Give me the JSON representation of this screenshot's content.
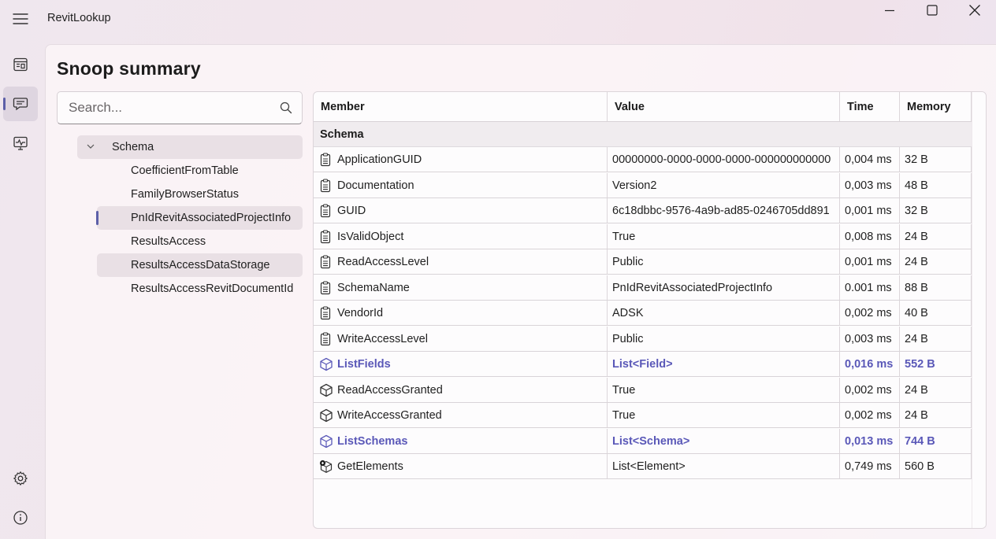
{
  "window": {
    "title": "RevitLookup"
  },
  "page": {
    "title": "Snoop summary"
  },
  "search": {
    "placeholder": "Search..."
  },
  "tree": {
    "root": "Schema",
    "items": [
      "CoefficientFromTable",
      "FamilyBrowserStatus",
      "PnIdRevitAssociatedProjectInfo",
      "ResultsAccess",
      "ResultsAccessDataStorage",
      "ResultsAccessRevitDocumentId"
    ],
    "selected_index": 2,
    "hover_index": 4
  },
  "table": {
    "columns": [
      "Member",
      "Value",
      "Time",
      "Memory"
    ],
    "group": "Schema",
    "rows": [
      {
        "member": "ApplicationGUID",
        "value": "00000000-0000-0000-0000-000000000000",
        "time": "0,004 ms",
        "memory": "32 B",
        "icon": "property-icon",
        "link": false
      },
      {
        "member": "Documentation",
        "value": "Version2",
        "time": "0,003 ms",
        "memory": "48 B",
        "icon": "property-icon",
        "link": false
      },
      {
        "member": "GUID",
        "value": "6c18dbbc-9576-4a9b-ad85-0246705dd891",
        "time": "0,001 ms",
        "memory": "32 B",
        "icon": "property-icon",
        "link": false
      },
      {
        "member": "IsValidObject",
        "value": "True",
        "time": "0,008 ms",
        "memory": "24 B",
        "icon": "property-icon",
        "link": false
      },
      {
        "member": "ReadAccessLevel",
        "value": "Public",
        "time": "0,001 ms",
        "memory": "24 B",
        "icon": "property-icon",
        "link": false
      },
      {
        "member": "SchemaName",
        "value": "PnIdRevitAssociatedProjectInfo",
        "time": "0.001 ms",
        "memory": "88 B",
        "icon": "property-icon",
        "link": false
      },
      {
        "member": "VendorId",
        "value": "ADSK",
        "time": "0,002 ms",
        "memory": "40 B",
        "icon": "property-icon",
        "link": false
      },
      {
        "member": "WriteAccessLevel",
        "value": "Public",
        "time": "0,003 ms",
        "memory": "24 B",
        "icon": "property-icon",
        "link": false
      },
      {
        "member": "ListFields",
        "value": "List<Field>",
        "time": "0,016 ms",
        "memory": "552 B",
        "icon": "method-cube-icon",
        "link": true
      },
      {
        "member": "ReadAccessGranted",
        "value": "True",
        "time": "0,002 ms",
        "memory": "24 B",
        "icon": "method-cube-icon",
        "link": false
      },
      {
        "member": "WriteAccessGranted",
        "value": "True",
        "time": "0,002 ms",
        "memory": "24 B",
        "icon": "method-cube-icon",
        "link": false
      },
      {
        "member": "ListSchemas",
        "value": "List<Schema>",
        "time": "0,013 ms",
        "memory": "744 B",
        "icon": "method-cube-icon",
        "link": true
      },
      {
        "member": "GetElements",
        "value": "List<Element>",
        "time": "0,749 ms",
        "memory": "560 B",
        "icon": "extension-method-icon",
        "link": false
      }
    ]
  },
  "colors": {
    "accent": "#5c5fa8",
    "link": "#5a58b8"
  }
}
